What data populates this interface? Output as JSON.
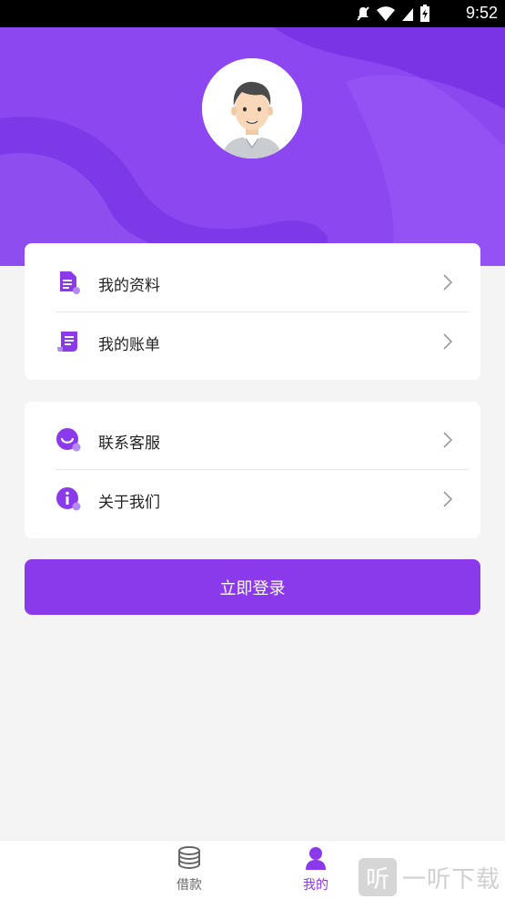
{
  "status_bar": {
    "time": "9:52",
    "icons": [
      "mute-icon",
      "wifi-icon",
      "signal-icon",
      "battery-charging-icon"
    ]
  },
  "profile": {
    "avatar_icon": "user-avatar"
  },
  "menu_card_1": {
    "items": [
      {
        "label": "我的资料",
        "icon": "document-icon"
      },
      {
        "label": "我的账单",
        "icon": "bill-icon"
      }
    ]
  },
  "menu_card_2": {
    "items": [
      {
        "label": "联系客服",
        "icon": "customer-service-icon"
      },
      {
        "label": "关于我们",
        "icon": "info-icon"
      }
    ]
  },
  "login_button": {
    "label": "立即登录"
  },
  "tab_bar": {
    "tabs": [
      {
        "label": "借款",
        "icon": "coins-icon",
        "active": false
      },
      {
        "label": "我的",
        "icon": "person-icon",
        "active": true
      }
    ]
  },
  "watermark": {
    "glyph": "听",
    "text": "一听下载"
  },
  "colors": {
    "accent": "#8a3aea",
    "inactive": "#666666"
  }
}
